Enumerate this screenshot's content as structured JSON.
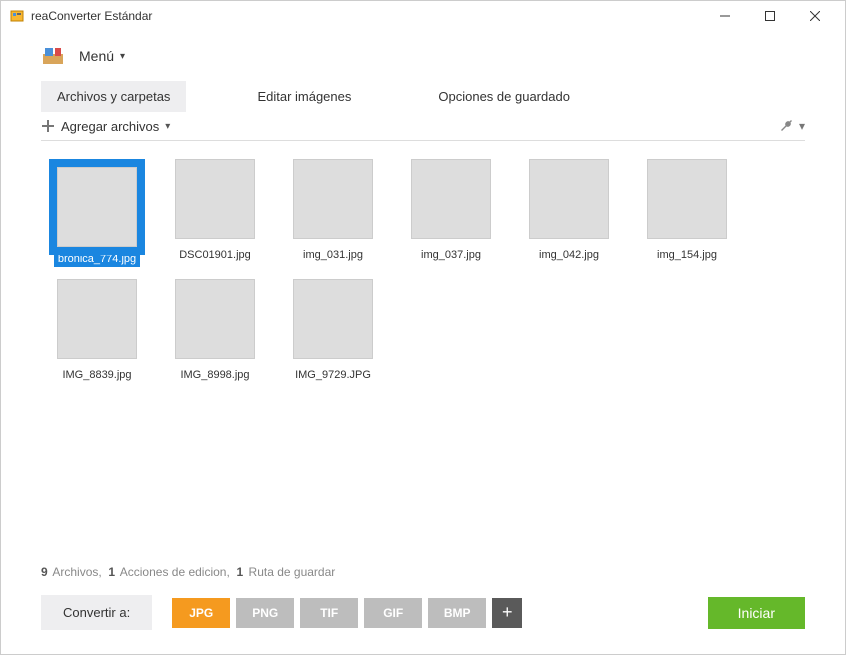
{
  "window": {
    "title": "reaConverter Estándar"
  },
  "menu": {
    "label": "Menú"
  },
  "tabs": {
    "files": "Archivos y carpetas",
    "edit": "Editar imágenes",
    "save": "Opciones de guardado"
  },
  "toolbar": {
    "add_files": "Agregar archivos"
  },
  "files": [
    {
      "name": "bronica_774.jpg",
      "selected": true
    },
    {
      "name": "DSC01901.jpg",
      "selected": false
    },
    {
      "name": "img_031.jpg",
      "selected": false
    },
    {
      "name": "img_037.jpg",
      "selected": false
    },
    {
      "name": "img_042.jpg",
      "selected": false
    },
    {
      "name": "img_154.jpg",
      "selected": false
    },
    {
      "name": "IMG_8839.jpg",
      "selected": false
    },
    {
      "name": "IMG_8998.jpg",
      "selected": false
    },
    {
      "name": "IMG_9729.JPG",
      "selected": false
    }
  ],
  "status": {
    "files_count": "9",
    "files_label": "Archivos,",
    "actions_count": "1",
    "actions_label": "Acciones de edicion,",
    "save_count": "1",
    "save_label": "Ruta de guardar"
  },
  "bottom": {
    "convert_to": "Convertir a:",
    "formats": [
      "JPG",
      "PNG",
      "TIF",
      "GIF",
      "BMP"
    ],
    "active_format": "JPG",
    "start": "Iniciar"
  }
}
